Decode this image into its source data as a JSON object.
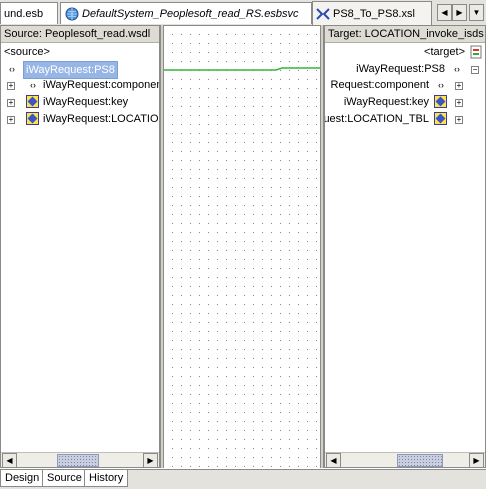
{
  "tabs": [
    {
      "label": "und.esb",
      "icon": "none"
    },
    {
      "label": "DefaultSystem_Peoplesoft_read_RS.esbsvc",
      "icon": "globe-icon"
    },
    {
      "label": "PS8_To_PS8.xsl",
      "icon": "xsl-icon"
    }
  ],
  "source_pane": {
    "header": "Source: Peoplesoft_read.wsdl",
    "root": "<source>",
    "nodes": [
      {
        "label": "iWayRequest:PS8",
        "selected": true
      },
      {
        "label": "iWayRequest:componen"
      },
      {
        "label": "iWayRequest:key"
      },
      {
        "label": "iWayRequest:LOCATIO"
      }
    ]
  },
  "target_pane": {
    "header": "Target: LOCATION_invoke_isds",
    "root": "<target>",
    "nodes": [
      {
        "label": "iWayRequest:PS8"
      },
      {
        "label": "Request:component"
      },
      {
        "label": "iWayRequest:key"
      },
      {
        "label": "uest:LOCATION_TBL"
      }
    ]
  },
  "bottom_tabs": [
    "Design",
    "Source",
    "History"
  ],
  "colors": {
    "mapping_line": "#3ab33a",
    "selection": "#97b6e6"
  }
}
